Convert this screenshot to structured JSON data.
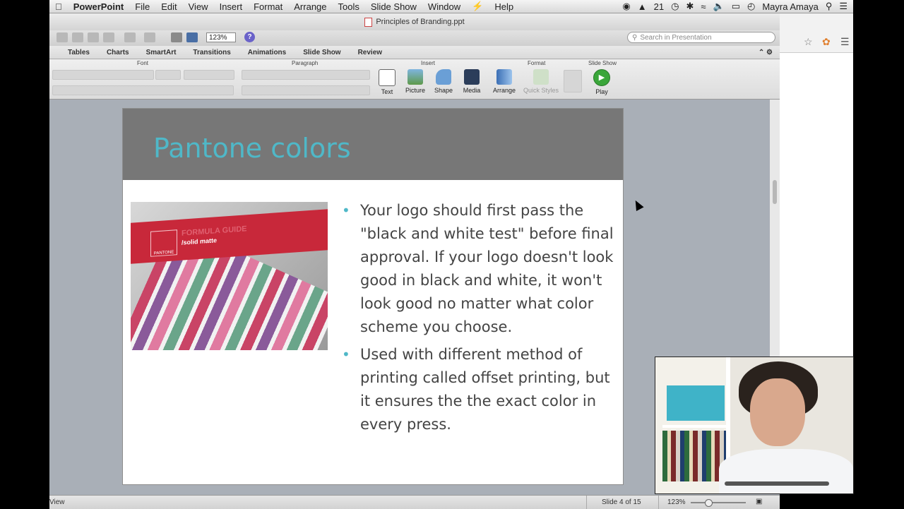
{
  "menubar": {
    "app_name": "PowerPoint",
    "items": [
      "File",
      "Edit",
      "View",
      "Insert",
      "Format",
      "Arrange",
      "Tools",
      "Slide Show",
      "Window",
      "Help"
    ],
    "status_num": "21",
    "user_name": "Mayra Amaya"
  },
  "window": {
    "title": "Principles of Branding.ppt"
  },
  "toolbar": {
    "zoom": "123%",
    "search_placeholder": "Search in Presentation"
  },
  "ribbon_tabs": [
    "Tables",
    "Charts",
    "SmartArt",
    "Transitions",
    "Animations",
    "Slide Show",
    "Review"
  ],
  "ribbon": {
    "groups": {
      "font": "Font",
      "paragraph": "Paragraph",
      "insert": "Insert",
      "format": "Format",
      "slideshow": "Slide Show"
    },
    "buttons": {
      "text": "Text",
      "picture": "Picture",
      "shape": "Shape",
      "media": "Media",
      "arrange": "Arrange",
      "quick_styles": "Quick Styles",
      "play": "Play"
    }
  },
  "slide": {
    "title": "Pantone colors",
    "photo_text": {
      "brand": "PANTONE",
      "guide": "FORMULA GUIDE",
      "finish": "/solid matte"
    },
    "bullets": [
      "Your logo should first pass the \"black and white test\" before final approval. If your logo doesn't look good in black and white, it won't look good no matter what color scheme you choose.",
      "Used with different method of printing called offset printing, but it ensures the the exact color in every press."
    ]
  },
  "statusbar": {
    "view": "View",
    "slide_counter": "Slide 4 of 15",
    "zoom": "123%"
  },
  "colors": {
    "accent": "#4fb8c8",
    "title_bar": "#777777",
    "body_text": "#444444"
  }
}
